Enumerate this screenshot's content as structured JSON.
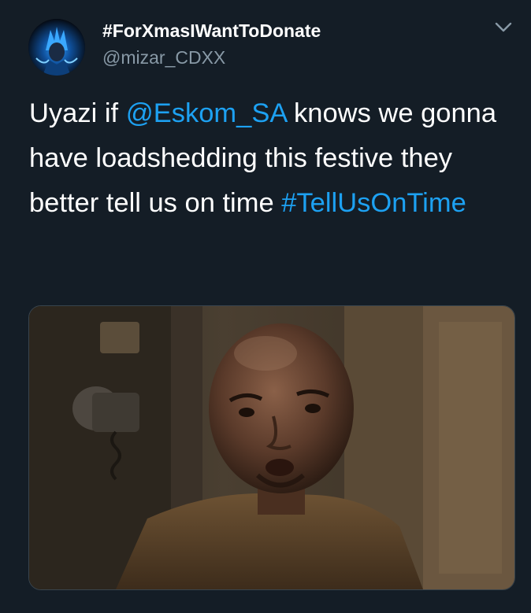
{
  "tweet": {
    "display_name": "#ForXmasIWantToDonate",
    "handle": "@mizar_CDXX",
    "text": {
      "part1": "Uyazi if ",
      "mention": "@Eskom_SA",
      "part2": " knows we gonna have loadshedding this festive they better tell us on time ",
      "hashtag": "#TellUsOnTime"
    }
  },
  "icons": {
    "caret": "chevron-down-icon",
    "avatar": "anime-avatar-image"
  },
  "colors": {
    "background": "#141d26",
    "text": "#ffffff",
    "secondary": "#8899a6",
    "link": "#1da1f2",
    "border": "#38444d"
  }
}
